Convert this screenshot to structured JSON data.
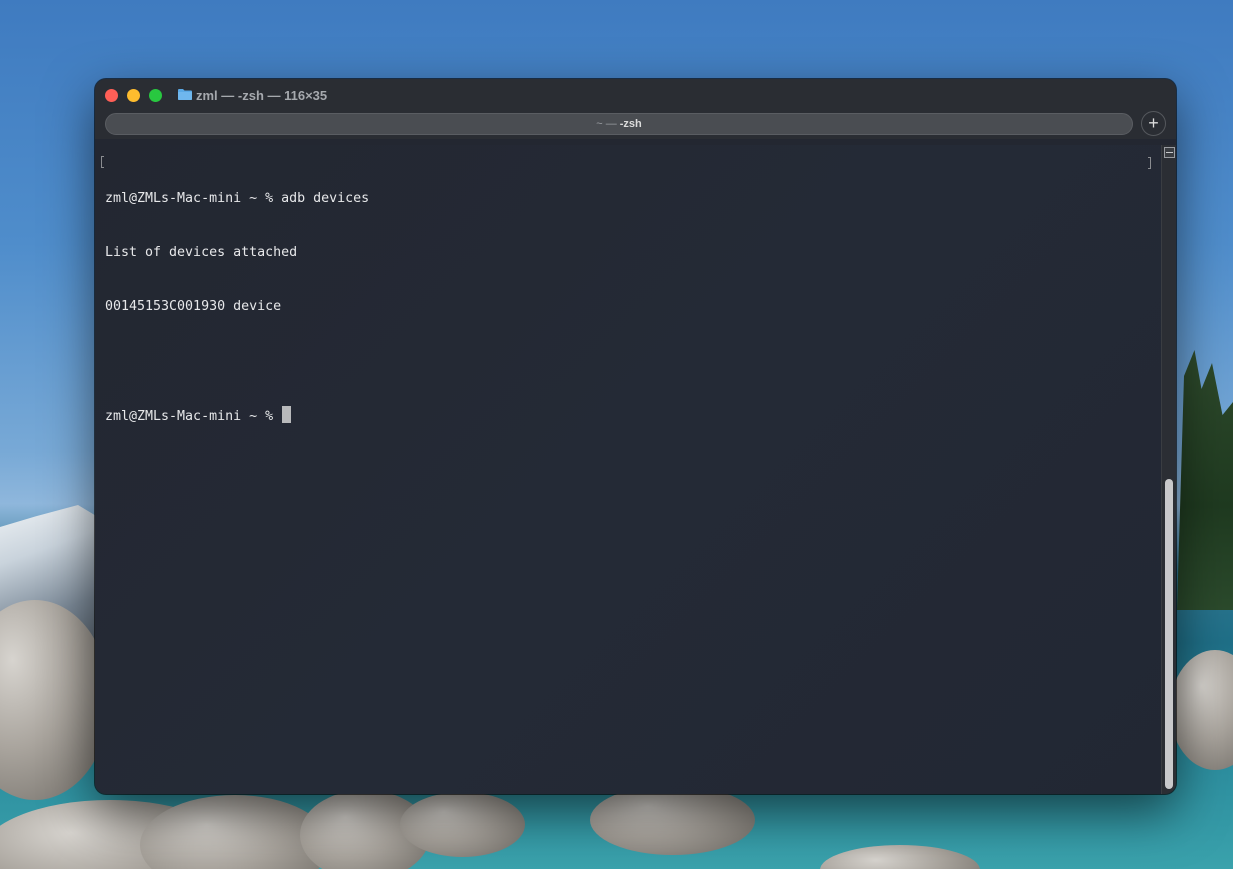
{
  "window": {
    "title": "zml — -zsh — 116×35",
    "folder_icon": "folder-icon",
    "controls": [
      "close-icon",
      "minimize-icon",
      "zoom-icon"
    ]
  },
  "tabs": [
    {
      "prefix": "~ — ",
      "label": "-zsh"
    }
  ],
  "new_tab_label": "+",
  "terminal": {
    "lines": [
      "zml@ZMLs-Mac-mini ~ % adb devices",
      "List of devices attached",
      "00145153C001930 device",
      "",
      "zml@ZMLs-Mac-mini ~ % "
    ]
  },
  "colors": {
    "close": "#ff5f57",
    "minimize": "#febc2e",
    "zoom": "#28c840",
    "terminal_bg": "#232731",
    "terminal_fg": "#e7e8ea"
  }
}
